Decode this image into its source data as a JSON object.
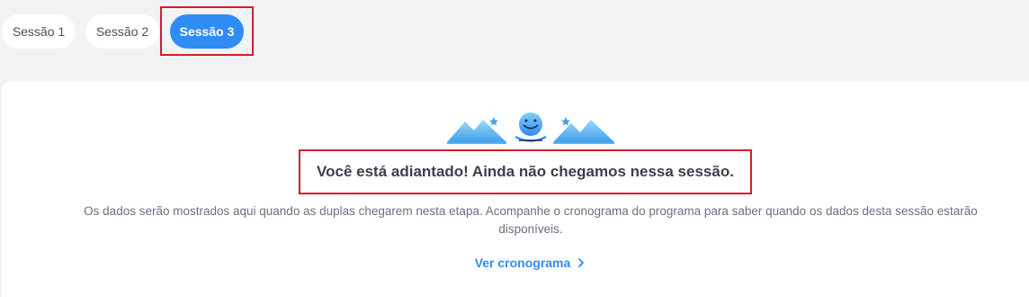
{
  "tabs": {
    "session1": "Sessão 1",
    "session2": "Sessão 2",
    "session3": "Sessão 3"
  },
  "colors": {
    "accent": "#2f8cf5",
    "highlight": "#d51f26",
    "illustration": "#55b3f0"
  },
  "empty_state": {
    "illustration": "mountains-smiley-icon",
    "title": "Você está adiantado! Ainda não chegamos nessa sessão.",
    "description": "Os dados serão mostrados aqui quando as duplas chegarem nesta etapa. Acompanhe o cronograma do programa para saber quando os dados desta sessão estarão disponíveis.",
    "link_label": "Ver cronograma",
    "link_icon": "chevron-right-icon"
  }
}
